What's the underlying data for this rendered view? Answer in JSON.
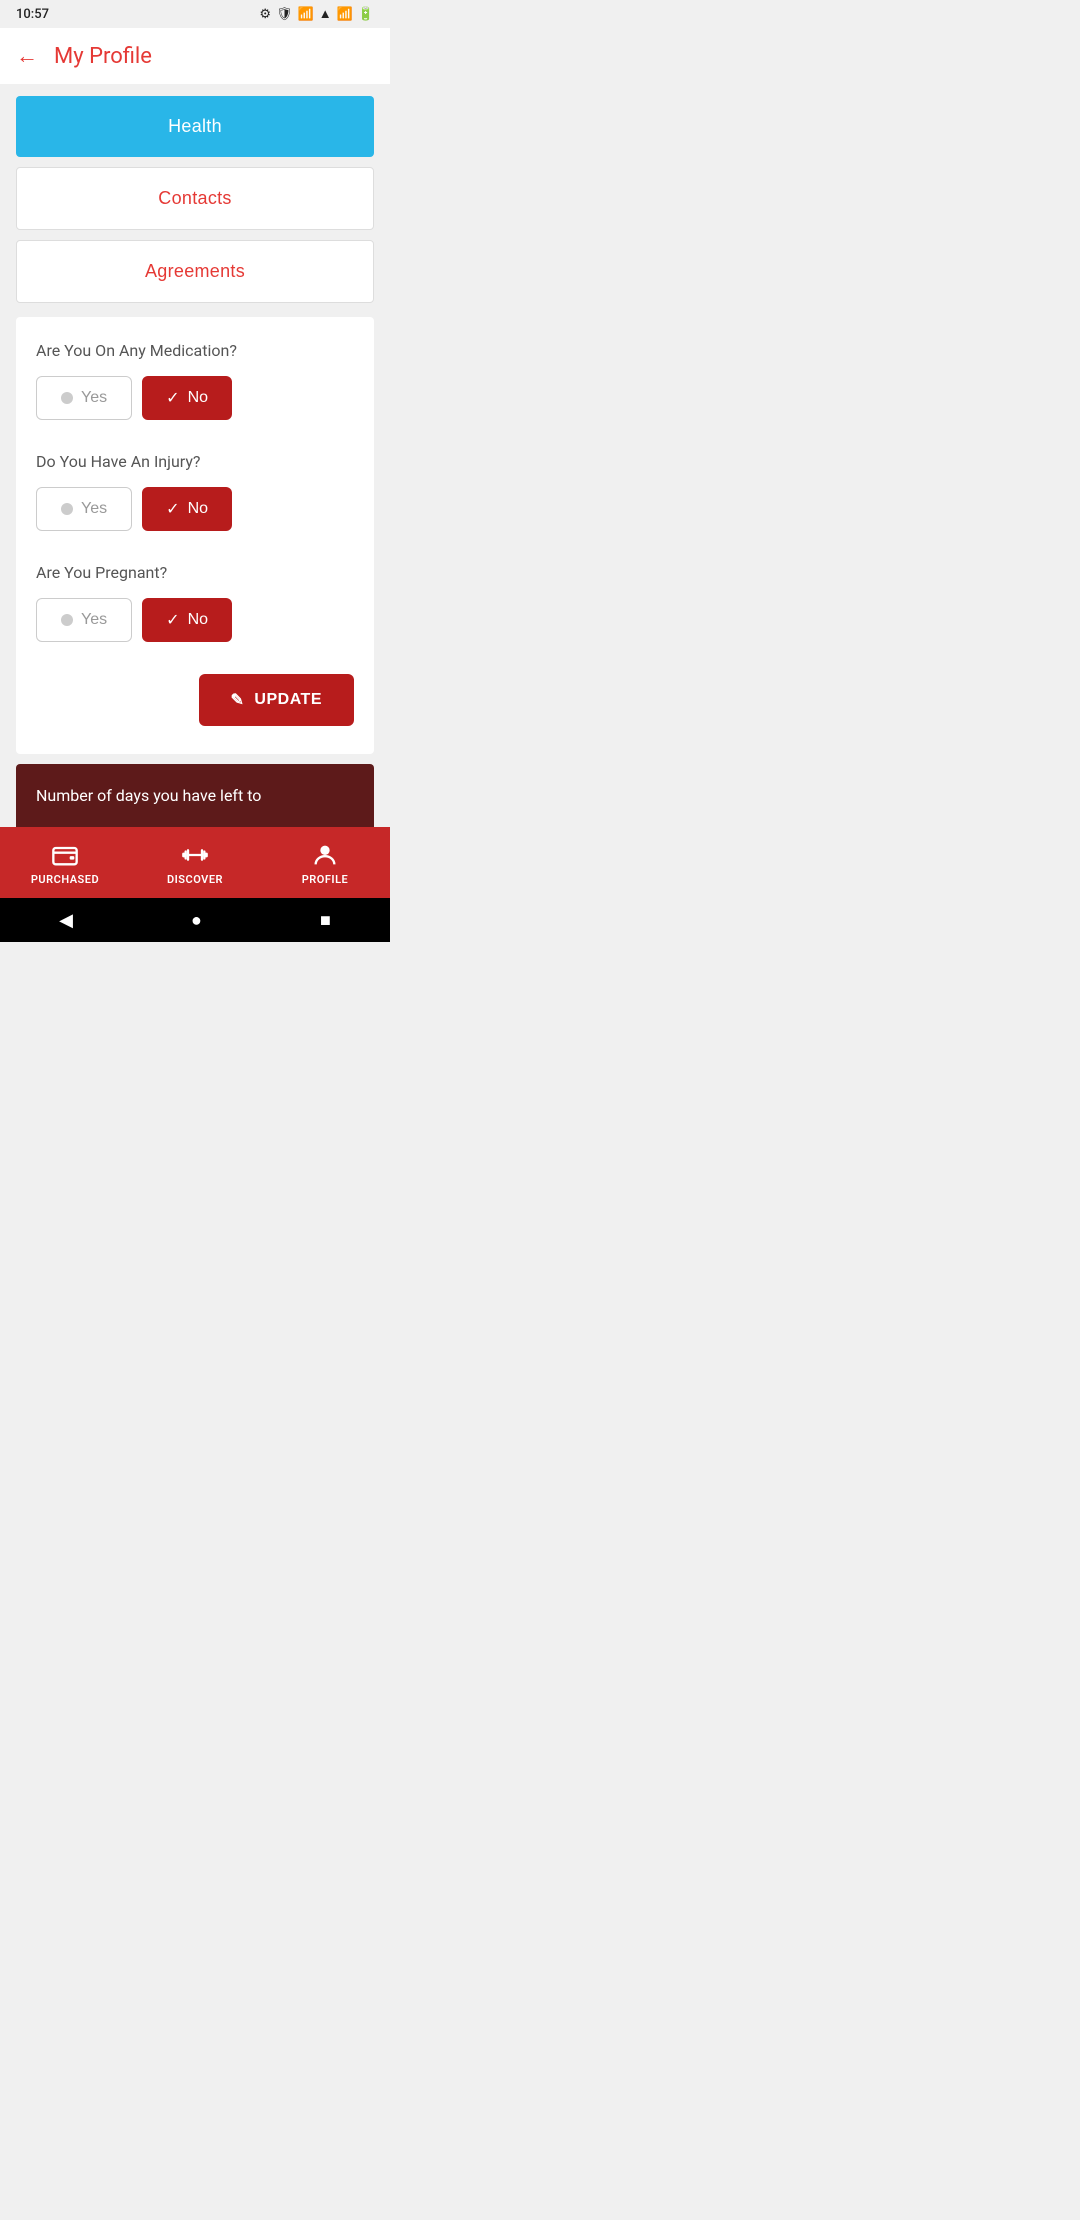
{
  "statusBar": {
    "time": "10:57"
  },
  "topBar": {
    "title": "My Profile",
    "backLabel": "←"
  },
  "tabs": {
    "health": "Health",
    "contacts": "Contacts",
    "agreements": "Agreements"
  },
  "healthForm": {
    "questions": [
      {
        "label": "Are You On Any Medication?",
        "yesLabel": "Yes",
        "noLabel": "No",
        "selected": "no"
      },
      {
        "label": "Do You Have An Injury?",
        "yesLabel": "Yes",
        "noLabel": "No",
        "selected": "no"
      },
      {
        "label": "Are You Pregnant?",
        "yesLabel": "Yes",
        "noLabel": "No",
        "selected": "no"
      }
    ],
    "updateLabel": "UPDATE"
  },
  "bottomTeaser": {
    "text": "Number of days you have left to"
  },
  "bottomNav": [
    {
      "id": "purchased",
      "label": "PURCHASED",
      "icon": "wallet"
    },
    {
      "id": "discover",
      "label": "DISCOVER",
      "icon": "dumbbell"
    },
    {
      "id": "profile",
      "label": "PROFILE",
      "icon": "person"
    }
  ],
  "sysNav": {
    "back": "◀",
    "home": "●",
    "recent": "■"
  }
}
